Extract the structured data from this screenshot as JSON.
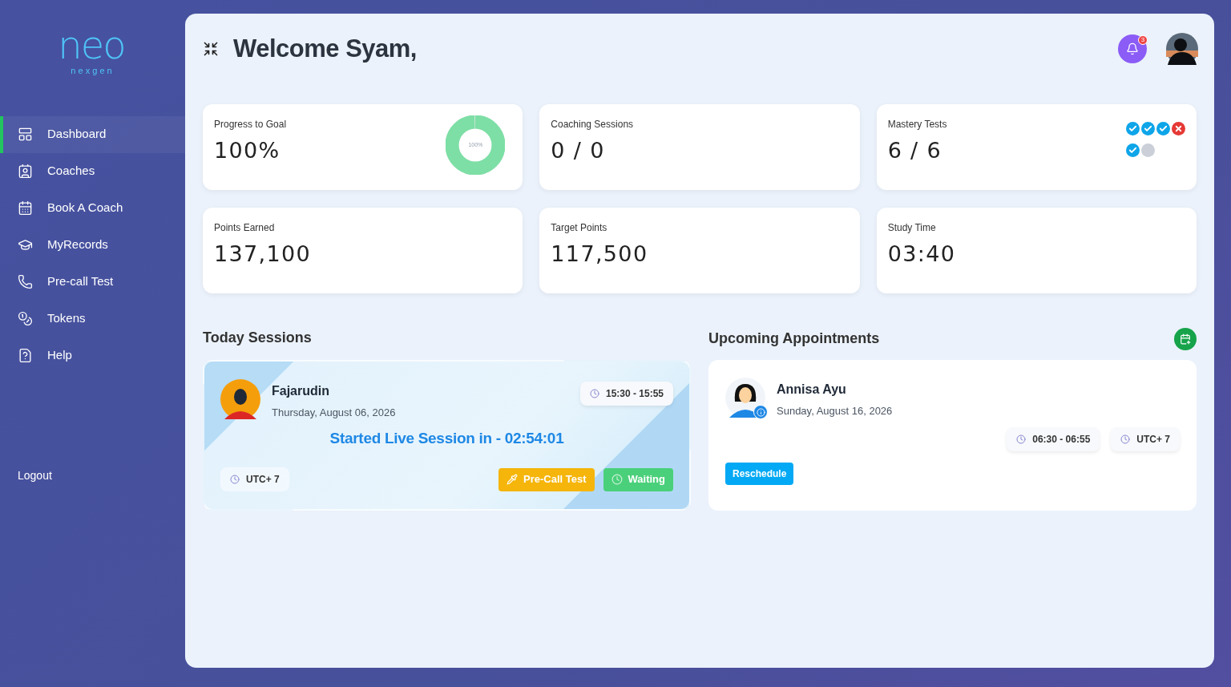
{
  "logo": {
    "mark": "neo",
    "subtitle": "n e x g e n"
  },
  "sidebar": {
    "items": [
      {
        "label": "Dashboard",
        "selected": true
      },
      {
        "label": "Coaches",
        "selected": false
      },
      {
        "label": "Book A Coach",
        "selected": false
      },
      {
        "label": "MyRecords",
        "selected": false
      },
      {
        "label": "Pre-call Test",
        "selected": false
      },
      {
        "label": "Tokens",
        "selected": false
      },
      {
        "label": "Help",
        "selected": false
      }
    ],
    "logout": "Logout"
  },
  "header": {
    "title": "Welcome Syam,",
    "notifications": "3"
  },
  "stats": [
    {
      "label": "Progress to Goal",
      "value": "100%",
      "kind": "ring",
      "level": 1,
      "ring_label": "100%"
    },
    {
      "label": "Coaching Sessions",
      "value": "0 / 0",
      "kind": "plain"
    },
    {
      "label": "Mastery Tests",
      "value": "6 / 6",
      "kind": "marks",
      "marks": [
        {
          "kind": "pass"
        },
        {
          "kind": "pass"
        },
        {
          "kind": "pass"
        },
        {
          "kind": "fail"
        },
        {
          "kind": "pass"
        },
        {
          "kind": "pending"
        }
      ]
    },
    {
      "label": "Points Earned",
      "value": "137,100",
      "kind": "plain"
    },
    {
      "label": "Target Points",
      "value": "117,500",
      "kind": "plain"
    },
    {
      "label": "Study Time",
      "value": "03:40",
      "kind": "plain"
    }
  ],
  "today_sessions": {
    "title": "Today Sessions",
    "session": {
      "name": "Fajarudin",
      "date": "Thursday, August 06, 2026",
      "time": "15:30 - 15:55",
      "countdown": "Started Live Session in - 02:54:01",
      "timezone": "UTC+ 7",
      "buttons": [
        {
          "label": "Pre-Call Test",
          "kind": "test"
        },
        {
          "label": "Waiting",
          "kind": "waiting"
        }
      ]
    }
  },
  "upcoming": {
    "title": "Upcoming Appointments",
    "appointment": {
      "name": "Annisa Ayu",
      "date": "Sunday, August 16, 2026",
      "time": "06:30 - 06:55",
      "timezone": "UTC+ 7",
      "button": "Reschedule"
    }
  }
}
